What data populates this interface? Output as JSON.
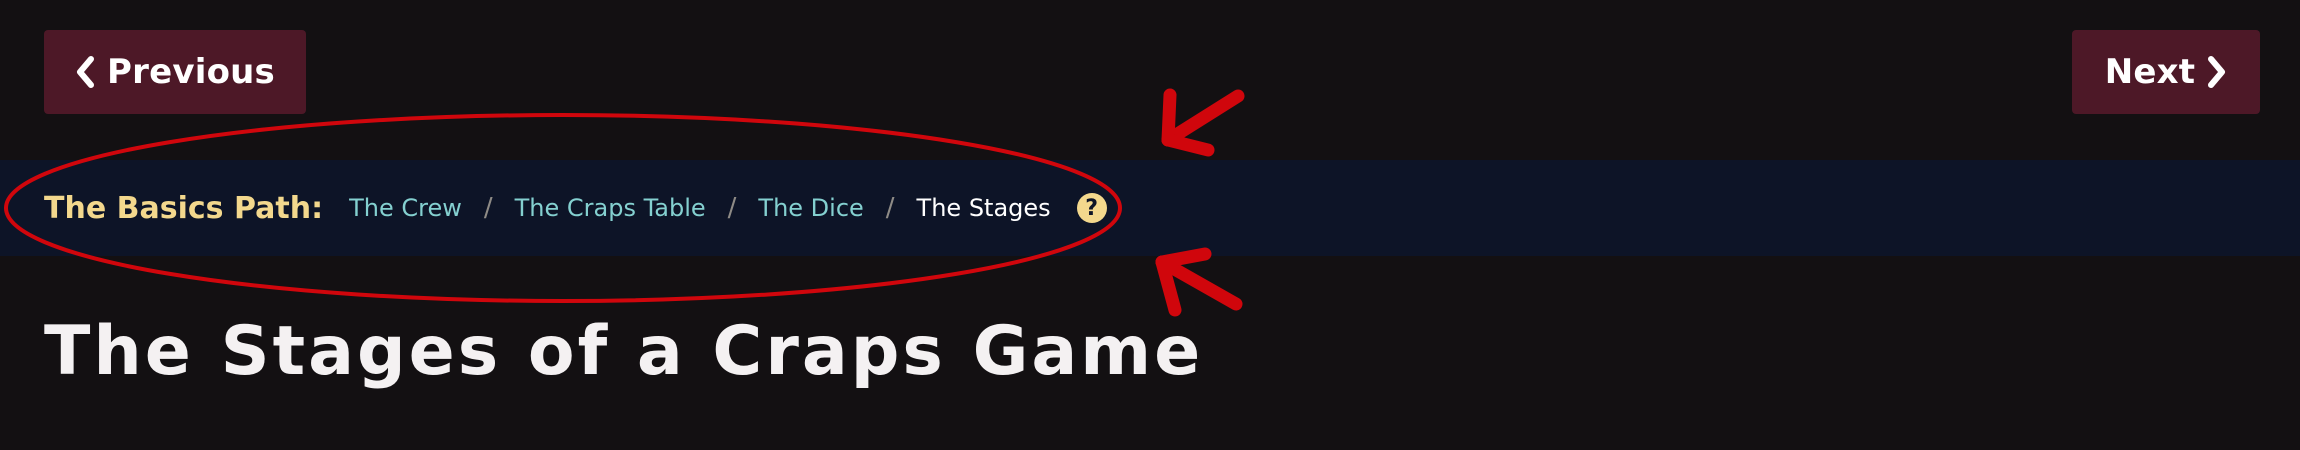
{
  "nav": {
    "previous_label": "Previous",
    "next_label": "Next"
  },
  "breadcrumb": {
    "path_label": "The Basics Path:",
    "links": [
      "The Crew",
      "The Craps Table",
      "The Dice"
    ],
    "separator": "/",
    "current": "The Stages",
    "help_icon": "?"
  },
  "page": {
    "title": "The Stages of a Craps Game"
  },
  "icons": {
    "previous": "chevron-left-icon",
    "next": "chevron-right-icon",
    "help": "question-circle-icon"
  },
  "colors": {
    "page_background": "#131012",
    "button_background": "#4d1827",
    "breadcrumb_background": "#0d1427",
    "path_label": "#f3d88d",
    "link": "#84d0d0",
    "annotation": "#d0060c"
  }
}
